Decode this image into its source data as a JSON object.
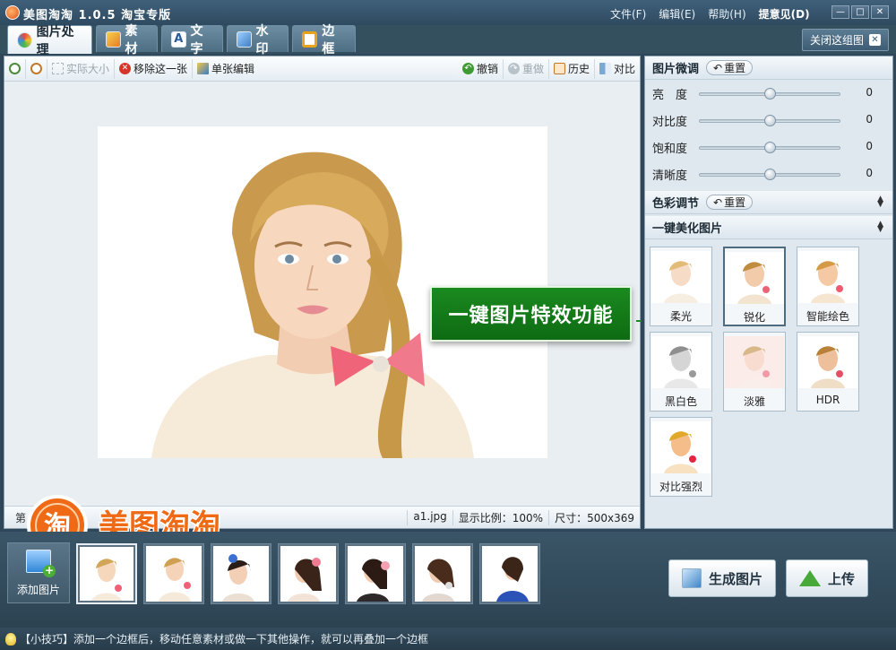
{
  "window": {
    "title": "美图淘淘 1.0.5 淘宝专版",
    "menu": [
      "文件(F)",
      "编辑(E)",
      "帮助(H)"
    ],
    "feedback": "提意见(D)",
    "controls": [
      "—",
      "□",
      "✕"
    ]
  },
  "tabs": [
    {
      "label": "图片处理",
      "icon": "palette-icon",
      "active": true
    },
    {
      "label": "素材",
      "icon": "sticker-icon",
      "active": false
    },
    {
      "label": "文字",
      "icon": "text-icon",
      "active": false
    },
    {
      "label": "水印",
      "icon": "watermark-icon",
      "active": false
    },
    {
      "label": "边框",
      "icon": "frame-icon",
      "active": false
    }
  ],
  "close_group": {
    "label": "关闭这组图",
    "icon": "close-icon"
  },
  "toolbar": {
    "actual_size": "实际大小",
    "remove_one": "移除这一张",
    "single_edit": "单张编辑",
    "undo": "撤销",
    "redo": "重做",
    "history": "历史",
    "compare": "对比"
  },
  "callout": {
    "text": "一键图片特效功能"
  },
  "status": {
    "left": "第　　　　张",
    "filename": "a1.jpg",
    "zoom": "显示比例：100%",
    "size": "尺寸：500x369"
  },
  "panel": {
    "fine_tune": {
      "title": "图片微调",
      "reset": "重置",
      "sliders": [
        {
          "label": "亮　度",
          "value": 0
        },
        {
          "label": "对比度",
          "value": 0
        },
        {
          "label": "饱和度",
          "value": 0
        },
        {
          "label": "清晰度",
          "value": 0
        }
      ]
    },
    "color": {
      "title": "色彩调节",
      "reset": "重置"
    },
    "one_click": {
      "title": "一键美化图片",
      "effects": [
        {
          "label": "柔光",
          "selected": false
        },
        {
          "label": "锐化",
          "selected": true
        },
        {
          "label": "智能绘色",
          "selected": false
        },
        {
          "label": "黑白色",
          "selected": false
        },
        {
          "label": "淡雅",
          "selected": false
        },
        {
          "label": "HDR",
          "selected": false
        },
        {
          "label": "对比强烈",
          "selected": false
        }
      ]
    }
  },
  "bottom": {
    "add_photo": "添加图片",
    "logo_text": "美图淘淘",
    "logo_glyph": "淘",
    "generate": "生成图片",
    "upload": "上传",
    "thumbnail_count": 7
  },
  "tip": {
    "text": "【小技巧】添加一个边框后，移动任意素材或做一下其他操作，就可以再叠加一个边框"
  },
  "colors": {
    "accent_green": "#0e6b13",
    "logo_orange": "#f06a16",
    "panel_bg": "#dfe8ef"
  }
}
